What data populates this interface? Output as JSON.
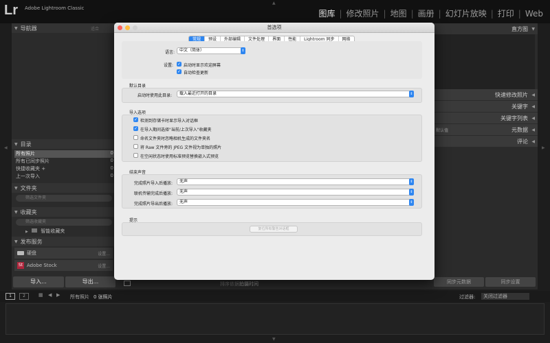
{
  "app": {
    "logo": "Lr",
    "title": "Adobe Lightroom Classic"
  },
  "modules": [
    "图库",
    "修改照片",
    "地图",
    "画册",
    "幻灯片放映",
    "打印",
    "Web"
  ],
  "left_panel": {
    "navigator": "导航器",
    "navigator_fit": "适合",
    "catalog": "目录",
    "catalog_items": [
      {
        "label": "所有照片",
        "count": "0"
      },
      {
        "label": "所有已同步照片",
        "count": "0"
      },
      {
        "label": "快捷收藏夹 +",
        "count": "0"
      },
      {
        "label": "上一次导入",
        "count": "0"
      }
    ],
    "folders": "文件夹",
    "folders_filter": "筛选文件夹",
    "collections": "收藏夹",
    "collections_filter": "筛选收藏夹",
    "smart_collections": "智能收藏夹",
    "publish_services": "发布服务",
    "publish_items": [
      {
        "label": "硬盘",
        "action": "设置..."
      },
      {
        "label": "Adobe Stock",
        "action": "设置..."
      }
    ],
    "import_button": "导入...",
    "export_button": "导出..."
  },
  "right_panel": {
    "histogram": "直方图",
    "sections": [
      "快速修改照片",
      "关键字",
      "关键字列表",
      "元数据",
      "评论"
    ],
    "metadata_preset": "默认值",
    "sync_meta": "同步元数据",
    "sync_settings": "同步设置"
  },
  "toolbar": {
    "sort_label": "排序依据:",
    "sort_value": "拍摄时间"
  },
  "filmstrip_bar": {
    "page1": "1",
    "page2": "2",
    "source": "所有照片",
    "count": "0 张照片",
    "filter_label": "过滤器:",
    "filter_value": "关闭过滤器"
  },
  "dialog": {
    "title": "首选项",
    "tabs": [
      "常规",
      "预设",
      "外部编辑",
      "文件处理",
      "界面",
      "性能",
      "Lightroom 同步",
      "网络"
    ],
    "active_tab": 0,
    "language_label": "语言:",
    "language_value": "中文（简体）",
    "settings_label": "设置:",
    "startup_checks": [
      {
        "label": "启动时显示欢迎屏幕",
        "checked": true
      },
      {
        "label": "自动检查更新",
        "checked": true
      }
    ],
    "default_catalog": "默认目录",
    "catalog_startup_label": "启动时使用此目录:",
    "catalog_startup_value": "载入最近打开的目录",
    "import_options": "导入选项",
    "import_checks": [
      {
        "label": "检测到存储卡时显示导入对话框",
        "checked": true
      },
      {
        "label": "在导入期间选择\"当前/上次导入\"收藏夹",
        "checked": true
      },
      {
        "label": "命名文件夹时忽略相机生成的文件夹名",
        "checked": false
      },
      {
        "label": "将 Raw 文件旁的 JPEG 文件视为单独的照片",
        "checked": false
      },
      {
        "label": "在空闲状态时使用标准预览替换嵌入式预览",
        "checked": false
      }
    ],
    "completion_sounds": "结束声音",
    "sounds": [
      {
        "label": "完成照片导入后播放:",
        "value": "无声"
      },
      {
        "label": "联机传输完成后播放:",
        "value": "无声"
      },
      {
        "label": "完成照片导出后播放:",
        "value": "无声"
      }
    ],
    "prompts": "提示",
    "reset_button": "复位所有警告对话框"
  }
}
